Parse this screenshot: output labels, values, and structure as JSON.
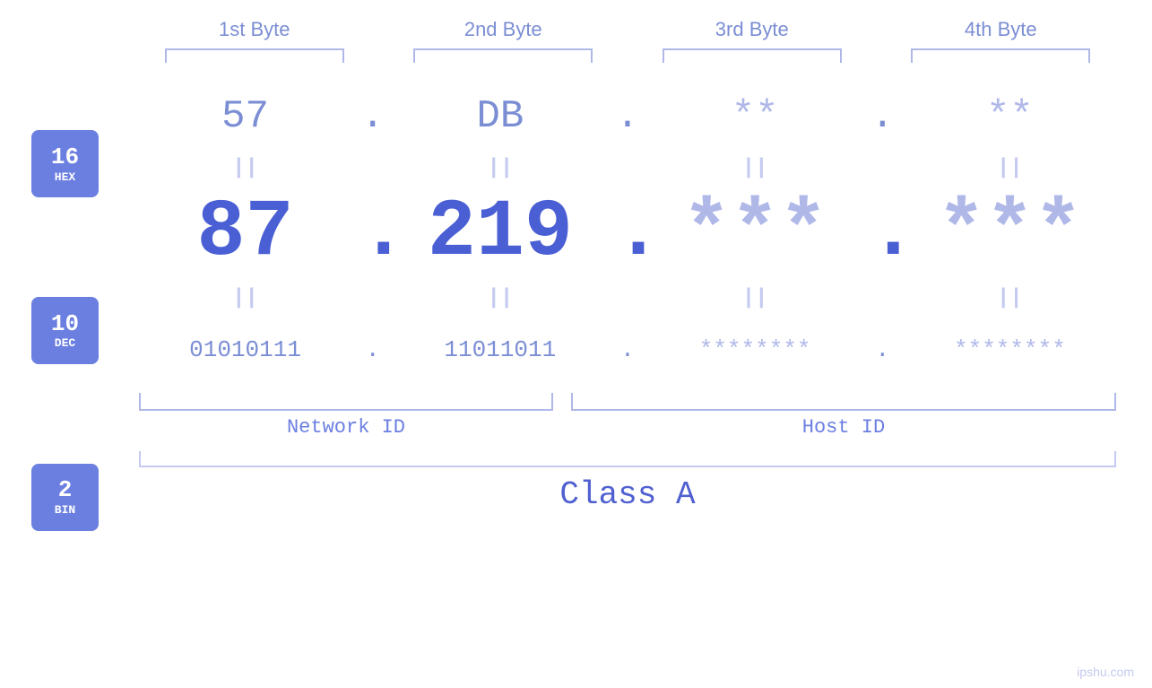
{
  "byteHeaders": [
    "1st Byte",
    "2nd Byte",
    "3rd Byte",
    "4th Byte"
  ],
  "badges": [
    {
      "number": "16",
      "label": "HEX"
    },
    {
      "number": "10",
      "label": "DEC"
    },
    {
      "number": "2",
      "label": "BIN"
    }
  ],
  "hexRow": {
    "values": [
      "57",
      "DB",
      "**",
      "**"
    ],
    "dots": [
      ".",
      ".",
      ".",
      "."
    ]
  },
  "decRow": {
    "values": [
      "87",
      "219",
      "***",
      "***"
    ],
    "dots": [
      ".",
      ".",
      ".",
      "."
    ]
  },
  "binRow": {
    "values": [
      "01010111",
      "11011011",
      "********",
      "********"
    ],
    "dots": [
      ".",
      ".",
      ".",
      "."
    ]
  },
  "networkIdLabel": "Network ID",
  "hostIdLabel": "Host ID",
  "classLabel": "Class A",
  "watermark": "ipshu.com",
  "separatorChar": "||"
}
